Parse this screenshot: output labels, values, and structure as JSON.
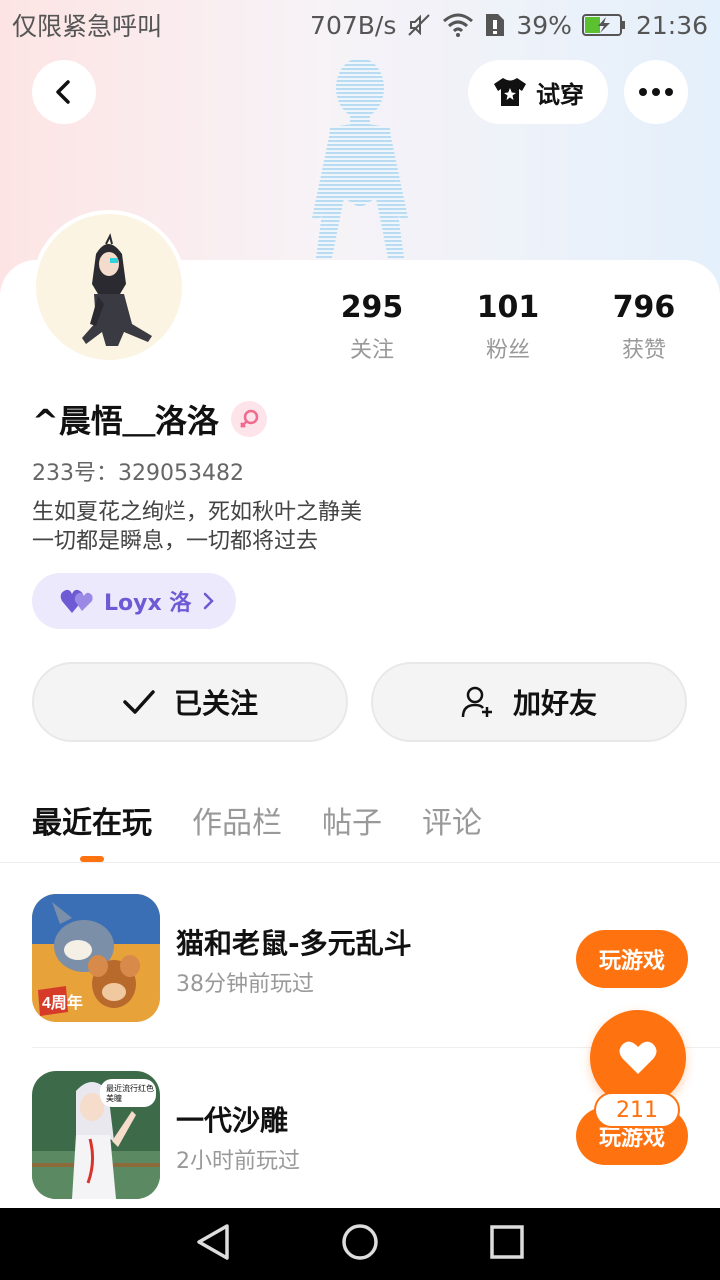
{
  "status_bar": {
    "left_text": "仅限紧急呼叫",
    "net_speed": "707B/s",
    "battery": "39%",
    "time": "21:36"
  },
  "header": {
    "back_icon": "chevron-left-icon",
    "try_on_label": "试穿",
    "more_icon": "more-dots-icon"
  },
  "profile": {
    "stats": [
      {
        "value": "295",
        "label": "关注"
      },
      {
        "value": "101",
        "label": "粉丝"
      },
      {
        "value": "796",
        "label": "获赞"
      }
    ],
    "nickname": "^晨悟＿洛洛",
    "gender_icon": "female-icon",
    "uid": "233号：329053482",
    "bio_lines": [
      "生如夏花之绚烂，死如秋叶之静美",
      "一切都是瞬息，一切都将过去"
    ],
    "tag_label": "Loyx 洛"
  },
  "actions": {
    "followed_label": "已关注",
    "add_friend_label": "加好友"
  },
  "tabs": [
    "最近在玩",
    "作品栏",
    "帖子",
    "评论"
  ],
  "games": [
    {
      "name": "猫和老鼠-多元乱斗",
      "time": "38分钟前玩过",
      "button": "玩游戏"
    },
    {
      "name": "一代沙雕",
      "time": "2小时前玩过",
      "button": "玩游戏"
    }
  ],
  "like": {
    "count": "211"
  },
  "colors": {
    "accent": "#ff7210",
    "tag_purple": "#6d5ad4"
  }
}
